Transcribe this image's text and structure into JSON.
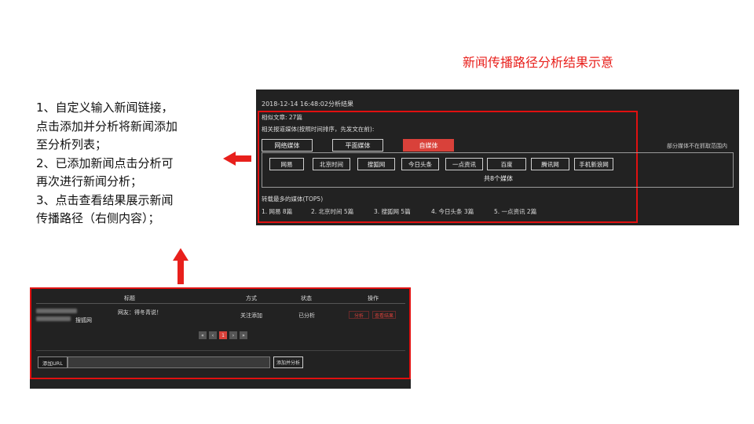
{
  "slide": {
    "title": "新闻传播路径分析结果示意",
    "instructions": [
      "1、自定义输入新闻链接，",
      "点击添加并分析将新闻添加",
      "至分析列表；",
      "2、已添加新闻点击分析可",
      "再次进行新闻分析；",
      "3、点击查看结果展示新闻",
      "传播路径（右侧内容）；"
    ]
  },
  "result": {
    "timestamp": "2018-12-14 16:48:02分析结果",
    "article_count": "相似文章: 27篇",
    "related_media_label": "相关报道媒体(按照时间排序，先发文在前):",
    "categories": [
      "网络媒体",
      "平面媒体",
      "自媒体"
    ],
    "side_note": "部分媒体不在抓取范围内",
    "media": [
      "网易",
      "北京时间",
      "搜狐网",
      "今日头条",
      "一点资讯",
      "百度",
      "腾讯网",
      "手机新浪网"
    ],
    "media_count": "共8个媒体",
    "top5_label": "转载最多的媒体(TOP5)",
    "top5": [
      "1. 网易  8篇",
      "2. 北京时间  5篇",
      "3. 搜狐网  5篇",
      "4. 今日头条  3篇",
      "5. 一点资讯  2篇"
    ]
  },
  "list": {
    "headers": [
      "标题",
      "方式",
      "状态",
      "操作"
    ],
    "row": {
      "title_suffix": "网友：得冬青说！",
      "source": "搜狐网",
      "method": "关注添加",
      "status": "已分析",
      "analyze": "分析",
      "view": "查看结果"
    },
    "pager": [
      "«",
      "‹",
      "1",
      "›",
      "»"
    ],
    "url_label": "添加URL",
    "add_button": "添加并分析"
  },
  "colors": {
    "accent": "#e8201c",
    "panel": "#222222",
    "active_tab": "#d9413a"
  }
}
